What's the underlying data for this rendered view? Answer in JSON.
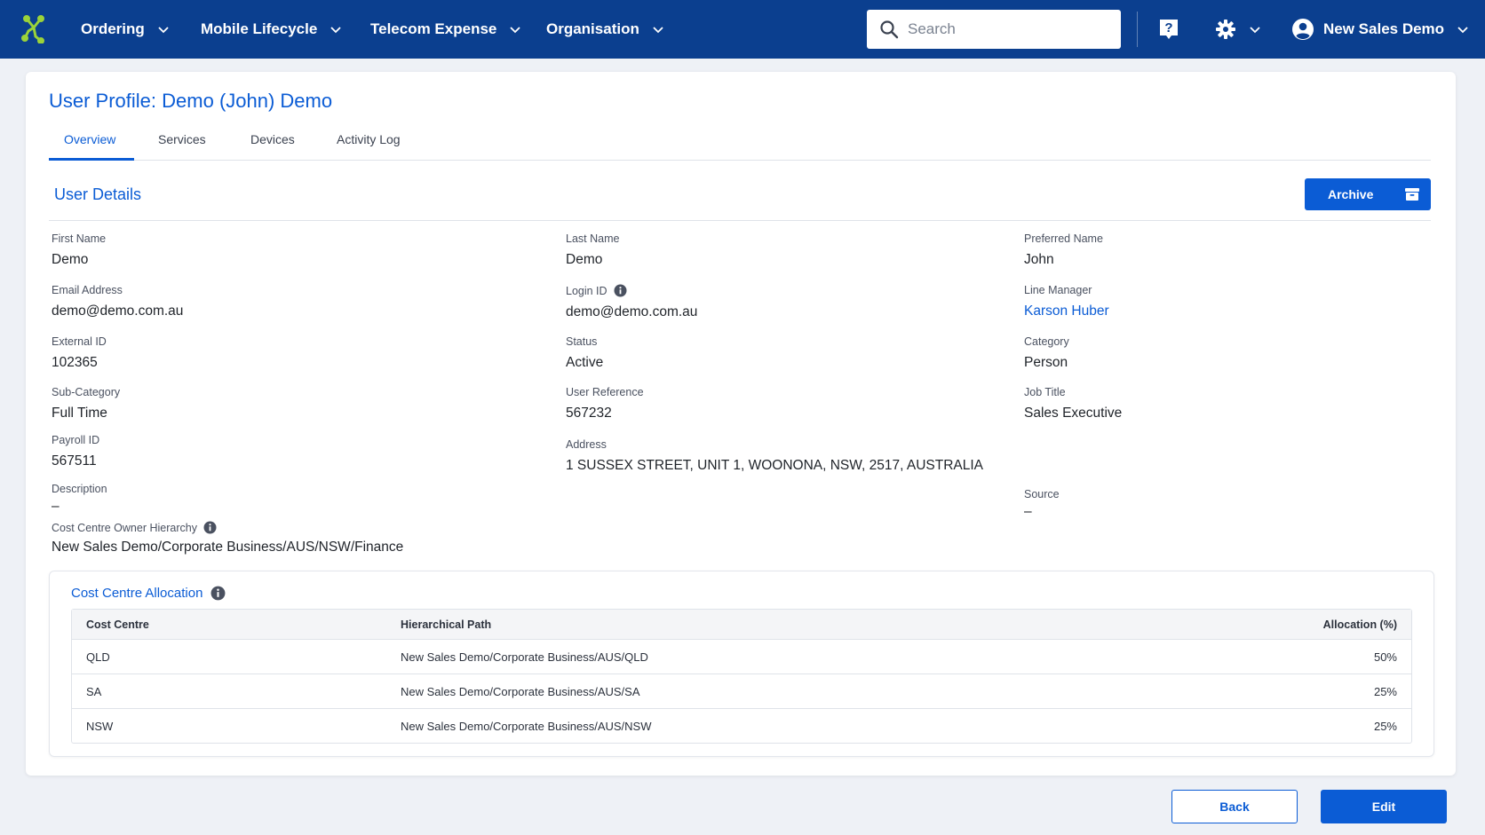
{
  "nav": {
    "logo_icon": "network-logo-icon",
    "items": [
      {
        "label": "Ordering"
      },
      {
        "label": "Mobile Lifecycle"
      },
      {
        "label": "Telecom Expense"
      },
      {
        "label": "Organisation"
      }
    ],
    "search_placeholder": "Search",
    "help_icon": "question-mark-icon",
    "settings_icon": "gear-icon",
    "user_name": "New Sales Demo"
  },
  "colors": {
    "header_bg": "#0b3f8f",
    "accent": "#0b5cd5",
    "logo": "#9bd33a"
  },
  "page": {
    "title": "User Profile: Demo (John) Demo",
    "tabs": [
      {
        "label": "Overview",
        "active": true
      },
      {
        "label": "Services",
        "active": false
      },
      {
        "label": "Devices",
        "active": false
      },
      {
        "label": "Activity Log",
        "active": false
      }
    ],
    "section_title": "User Details",
    "archive_label": "Archive"
  },
  "fields": {
    "first_name": {
      "label": "First Name",
      "value": "Demo"
    },
    "last_name": {
      "label": "Last Name",
      "value": "Demo"
    },
    "preferred_name": {
      "label": "Preferred Name",
      "value": "John"
    },
    "email": {
      "label": "Email Address",
      "value": "demo@demo.com.au"
    },
    "login_id": {
      "label": "Login ID",
      "value": "demo@demo.com.au"
    },
    "line_manager": {
      "label": "Line Manager",
      "value": "Karson Huber"
    },
    "external_id": {
      "label": "External ID",
      "value": "102365"
    },
    "status": {
      "label": "Status",
      "value": "Active"
    },
    "category": {
      "label": "Category",
      "value": "Person"
    },
    "sub_category": {
      "label": "Sub-Category",
      "value": "Full Time"
    },
    "user_reference": {
      "label": "User Reference",
      "value": "567232"
    },
    "job_title": {
      "label": "Job Title",
      "value": "Sales Executive"
    },
    "payroll_id": {
      "label": "Payroll ID",
      "value": "567511"
    },
    "address": {
      "label": "Address",
      "value": "1 SUSSEX STREET, UNIT 1, WOONONA, NSW, 2517, AUSTRALIA"
    },
    "description": {
      "label": "Description",
      "value": "–"
    },
    "source": {
      "label": "Source",
      "value": "–"
    },
    "cost_centre_owner": {
      "label": "Cost Centre Owner Hierarchy",
      "value": "New Sales Demo/Corporate Business/AUS/NSW/Finance"
    }
  },
  "allocation": {
    "title": "Cost Centre Allocation",
    "headers": {
      "cost_centre": "Cost Centre",
      "path": "Hierarchical Path",
      "allocation": "Allocation (%)"
    },
    "rows": [
      {
        "cost_centre": "QLD",
        "path": "New Sales Demo/Corporate Business/AUS/QLD",
        "allocation": "50%"
      },
      {
        "cost_centre": "SA",
        "path": "New Sales Demo/Corporate Business/AUS/SA",
        "allocation": "25%"
      },
      {
        "cost_centre": "NSW",
        "path": "New Sales Demo/Corporate Business/AUS/NSW",
        "allocation": "25%"
      }
    ]
  },
  "footer": {
    "back_label": "Back",
    "edit_label": "Edit"
  }
}
